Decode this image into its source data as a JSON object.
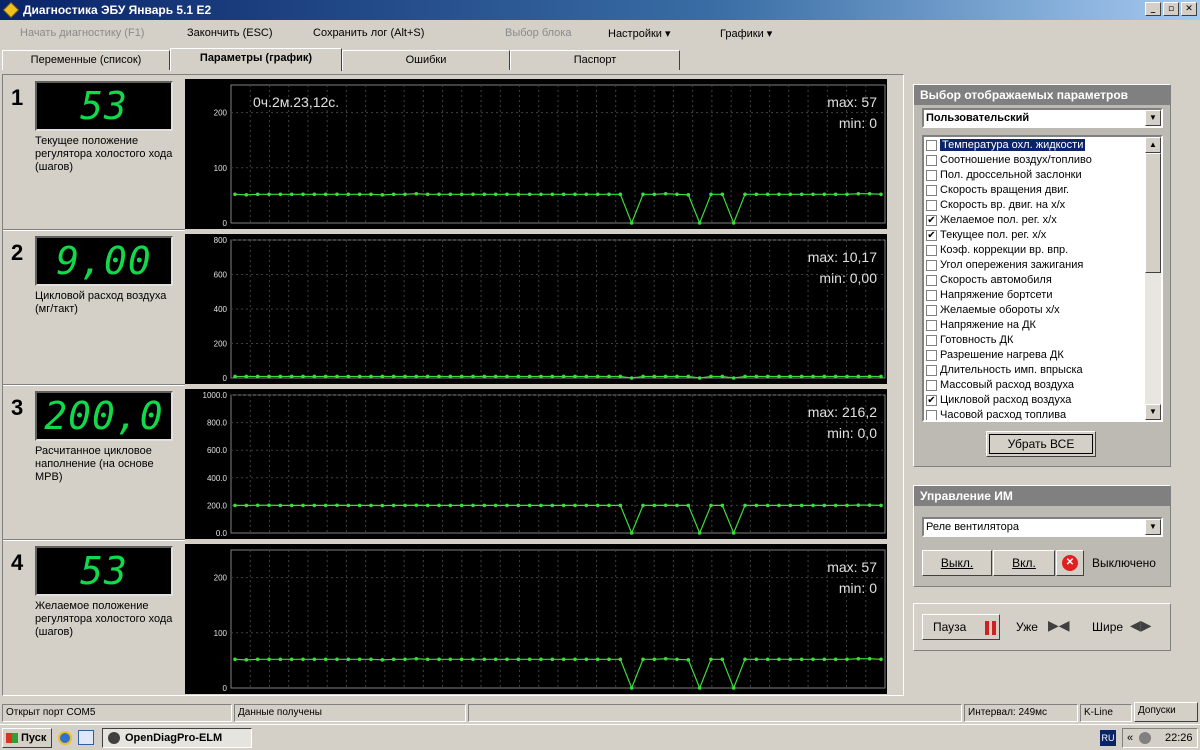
{
  "window": {
    "title": "Диагностика ЭБУ Январь 5.1 E2"
  },
  "menu": {
    "start_diag": "Начать диагностику (F1)",
    "finish": "Закончить (ESC)",
    "save_log": "Сохранить лог (Alt+S)",
    "select_block": "Выбор блока",
    "settings": "Настройки ▾",
    "charts": "Графики ▾"
  },
  "tabs": [
    "Переменные (список)",
    "Параметры (график)",
    "Ошибки",
    "Паспорт"
  ],
  "rows": [
    {
      "num": "1",
      "value": "53",
      "label": "Текущее положение регулятора холостого хода (шагов)",
      "time": "0ч.2м.23,12с.",
      "max": "max: 57",
      "min": "min: 0",
      "yticks": [
        "200",
        "100",
        "0"
      ]
    },
    {
      "num": "2",
      "value": "9,00",
      "label": "Цикловой расход воздуха (мг/такт)",
      "time": "",
      "max": "max: 10,17",
      "min": "min: 0,00",
      "yticks": [
        "800",
        "600",
        "400",
        "200",
        "0"
      ]
    },
    {
      "num": "3",
      "value": "200,0",
      "label": "Расчитанное цикловое наполнение (на основе МРВ)",
      "time": "",
      "max": "max: 216,2",
      "min": "min: 0,0",
      "yticks": [
        "1000.0",
        "800.0",
        "600.0",
        "400.0",
        "200.0",
        "0.0"
      ]
    },
    {
      "num": "4",
      "value": "53",
      "label": "Желаемое положение регулятора холостого хода (шагов)",
      "time": "",
      "max": "max: 57",
      "min": "min: 0",
      "yticks": [
        "200",
        "100",
        "0"
      ]
    }
  ],
  "chart_data": [
    {
      "type": "line",
      "ylim": [
        0,
        250
      ],
      "yticks": [
        0,
        100,
        200
      ],
      "values": [
        52,
        51,
        52,
        52,
        52,
        52,
        52,
        52,
        52,
        52,
        52,
        52,
        52,
        51,
        52,
        52,
        53,
        52,
        52,
        52,
        52,
        52,
        52,
        52,
        52,
        52,
        52,
        52,
        52,
        52,
        52,
        52,
        52,
        52,
        52,
        0,
        52,
        52,
        53,
        52,
        51,
        0,
        52,
        52,
        0,
        52,
        52,
        52,
        52,
        52,
        52,
        52,
        52,
        52,
        52,
        53,
        53,
        52
      ],
      "color": "#3cdc3c"
    },
    {
      "type": "line",
      "ylim": [
        0,
        800
      ],
      "yticks": [
        0,
        200,
        400,
        600,
        800
      ],
      "values": [
        9,
        9,
        9,
        9,
        9,
        9,
        9,
        9,
        9,
        9,
        9,
        9,
        9,
        9,
        9,
        9,
        9,
        9,
        9,
        9,
        9,
        9,
        9,
        9,
        9,
        9,
        9,
        9,
        9,
        9,
        9,
        9,
        9,
        9,
        9,
        0,
        9,
        9,
        9,
        9,
        9,
        0,
        9,
        9,
        0,
        9,
        9,
        9,
        9,
        9,
        9,
        9,
        9,
        9,
        9,
        9,
        9,
        9
      ],
      "color": "#3cdc3c"
    },
    {
      "type": "line",
      "ylim": [
        0,
        1000
      ],
      "yticks": [
        0,
        200,
        400,
        600,
        800,
        1000
      ],
      "values": [
        200,
        200,
        201,
        201,
        200,
        200,
        200,
        200,
        200,
        201,
        200,
        200,
        200,
        199,
        200,
        200,
        201,
        200,
        200,
        200,
        200,
        200,
        200,
        200,
        200,
        200,
        200,
        200,
        200,
        200,
        200,
        200,
        200,
        200,
        200,
        0,
        200,
        200,
        201,
        200,
        200,
        0,
        200,
        200,
        0,
        200,
        200,
        200,
        200,
        200,
        200,
        200,
        200,
        200,
        200,
        202,
        202,
        200
      ],
      "color": "#3cdc3c"
    },
    {
      "type": "line",
      "ylim": [
        0,
        250
      ],
      "yticks": [
        0,
        100,
        200
      ],
      "values": [
        52,
        51,
        52,
        52,
        52,
        52,
        52,
        52,
        52,
        52,
        52,
        52,
        52,
        51,
        52,
        52,
        53,
        52,
        52,
        52,
        52,
        52,
        52,
        52,
        52,
        52,
        52,
        52,
        52,
        52,
        52,
        52,
        52,
        52,
        52,
        0,
        52,
        52,
        53,
        52,
        51,
        0,
        52,
        52,
        0,
        52,
        52,
        52,
        52,
        52,
        52,
        52,
        52,
        52,
        52,
        53,
        53,
        52
      ],
      "color": "#3cdc3c"
    }
  ],
  "params_panel": {
    "title": "Выбор отображаемых параметров",
    "preset": "Пользовательский",
    "items": [
      {
        "label": "Температура охл. жидкости",
        "checked": false,
        "selected": true
      },
      {
        "label": "Соотношение воздух/топливо",
        "checked": false
      },
      {
        "label": "Пол. дроссельной заслонки",
        "checked": false
      },
      {
        "label": "Скорость вращения двиг.",
        "checked": false
      },
      {
        "label": "Скорость вр. двиг. на х/х",
        "checked": false
      },
      {
        "label": "Желаемое пол. рег. х/х",
        "checked": true
      },
      {
        "label": "Текущее пол. рег. х/х",
        "checked": true
      },
      {
        "label": "Коэф. коррекции вр. впр.",
        "checked": false
      },
      {
        "label": "Угол опережения зажигания",
        "checked": false
      },
      {
        "label": "Скорость автомобиля",
        "checked": false
      },
      {
        "label": "Напряжение бортсети",
        "checked": false
      },
      {
        "label": "Желаемые обороты х/х",
        "checked": false
      },
      {
        "label": "Напряжение на ДК",
        "checked": false
      },
      {
        "label": "Готовность ДК",
        "checked": false
      },
      {
        "label": "Разрешение нагрева ДК",
        "checked": false
      },
      {
        "label": "Длительность имп. впрыска",
        "checked": false
      },
      {
        "label": "Массовый расход воздуха",
        "checked": false
      },
      {
        "label": "Цикловой расход воздуха",
        "checked": true
      },
      {
        "label": "Часовой расход топлива",
        "checked": false
      }
    ],
    "remove_all": "Убрать ВСЕ"
  },
  "im_panel": {
    "title": "Управление ИМ",
    "device": "Реле вентилятора",
    "off_btn": "Выкл.",
    "on_btn": "Вкл.",
    "status": "Выключено"
  },
  "playback": {
    "pause": "Пауза",
    "narrow": "Уже",
    "wider": "Шире"
  },
  "status": {
    "port": "Открыт порт COM5",
    "data": "Данные получены",
    "interval": "Интервал: 249мс",
    "line": "K-Line",
    "tolerances": "Допуски"
  },
  "taskbar": {
    "start": "Пуск",
    "task": "OpenDiagPro-ELM",
    "lang": "RU",
    "clock": "22:26"
  },
  "colors": {
    "digit": "#12d84c",
    "trace": "#3cdc3c",
    "selection": "#0a246a"
  }
}
